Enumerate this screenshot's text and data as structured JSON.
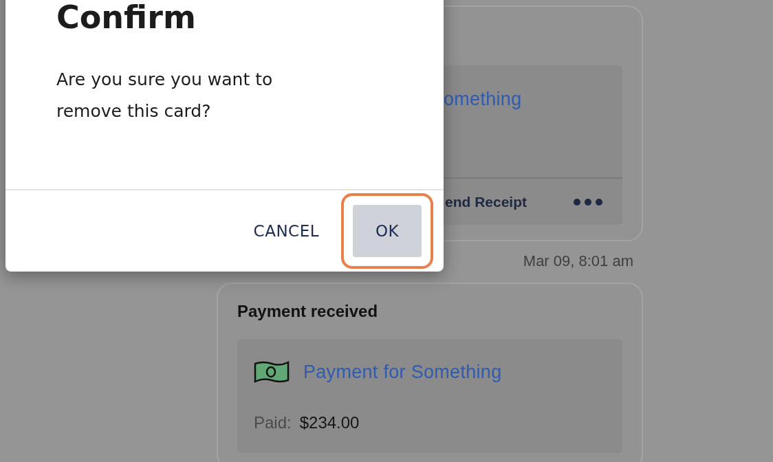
{
  "dialog": {
    "title": "Confirm",
    "message": "Are you sure you want to remove this card?",
    "buttons": [
      {
        "label": "CANCEL",
        "kind": "text",
        "highlighted": false
      },
      {
        "label": "OK",
        "kind": "filled",
        "highlighted": true
      }
    ]
  },
  "feed": [
    {
      "kind": "partial",
      "link": "omething",
      "action": "end Receipt",
      "time": "Mar 09, 8:01 am"
    },
    {
      "kind": "payment",
      "heading": "Payment received",
      "link": "Payment for Something",
      "paid_label": "Paid:",
      "amount": "$234.00"
    }
  ]
}
